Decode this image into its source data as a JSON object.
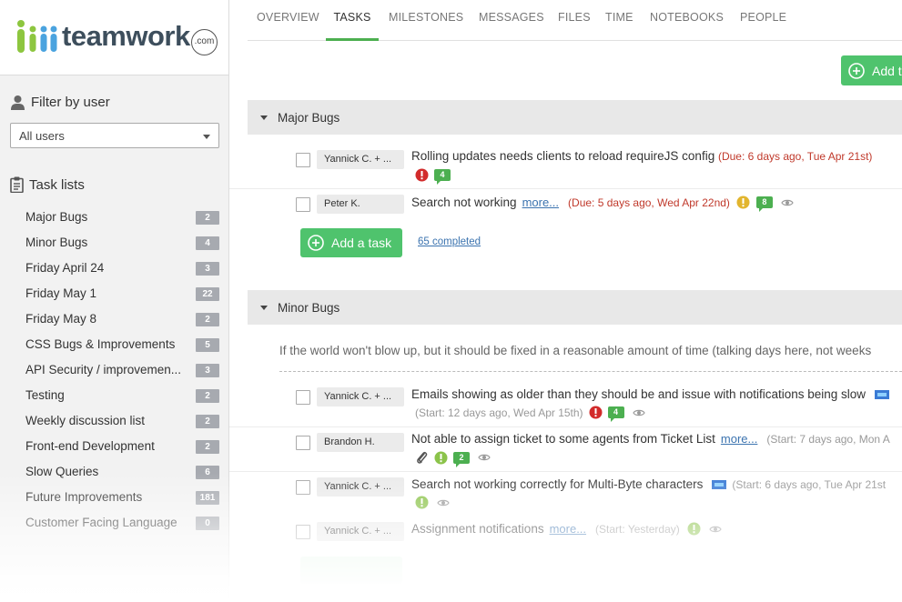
{
  "app": {
    "logo_text": "teamwork",
    "logo_suffix": ".com"
  },
  "sidebar": {
    "filter_heading": "Filter by user",
    "filter_value": "All users",
    "tasklists_heading": "Task lists",
    "task_lists": [
      {
        "name": "Major Bugs",
        "count": "2"
      },
      {
        "name": "Minor Bugs",
        "count": "4"
      },
      {
        "name": "Friday April 24",
        "count": "3"
      },
      {
        "name": "Friday May 1",
        "count": "22"
      },
      {
        "name": "Friday May 8",
        "count": "2"
      },
      {
        "name": "CSS Bugs & Improvements",
        "count": "5"
      },
      {
        "name": "API Security / improvemen...",
        "count": "3"
      },
      {
        "name": "Testing",
        "count": "2"
      },
      {
        "name": "Weekly discussion list",
        "count": "2"
      },
      {
        "name": "Front-end Development",
        "count": "2"
      },
      {
        "name": "Slow Queries",
        "count": "6"
      },
      {
        "name": "Future Improvements",
        "count": "181"
      },
      {
        "name": "Customer Facing Language",
        "count": "0"
      }
    ]
  },
  "nav": {
    "tabs": [
      "OVERVIEW",
      "TASKS",
      "MILESTONES",
      "MESSAGES",
      "FILES",
      "TIME",
      "NOTEBOOKS",
      "PEOPLE"
    ],
    "active": "TASKS"
  },
  "main": {
    "add_top_label": "Add t",
    "major": {
      "title": "Major Bugs",
      "tasks": [
        {
          "assignee": "Yannick C. + ...",
          "title": "Rolling updates needs clients to reload requireJS config",
          "due": "(Due: 6 days ago, Tue Apr 21st)",
          "comments": "4"
        },
        {
          "assignee": "Peter K.",
          "title": "Search not working",
          "more": "more...",
          "due": "(Due: 5 days ago, Wed Apr 22nd)",
          "comments": "8"
        }
      ],
      "add_task_label": "Add a task",
      "completed_label": "65 completed"
    },
    "minor": {
      "title": "Minor Bugs",
      "description": "If the world won't blow up, but it should be fixed in a reasonable amount of time (talking days here, not weeks",
      "tasks": [
        {
          "assignee": "Yannick C. + ...",
          "title": "Emails showing as older than they should be and issue with notifications being slow",
          "meta": "(Start: 12 days ago, Wed Apr 15th)",
          "comments": "4"
        },
        {
          "assignee": "Brandon H.",
          "title": "Not able to assign ticket to some agents from Ticket List",
          "more": "more...",
          "meta": "(Start: 7 days ago, Mon A",
          "comments": "2"
        },
        {
          "assignee": "Yannick C. + ...",
          "title": "Search not working correctly for Multi-Byte characters",
          "meta": "(Start: 6 days ago, Tue Apr 21st"
        },
        {
          "assignee": "Yannick C. + ...",
          "title": "Assignment notifications",
          "more": "more...",
          "meta": "(Start: Yesterday)"
        }
      ]
    }
  },
  "colors": {
    "accent_green": "#4fc36d",
    "due_red": "#c0392b",
    "link_blue": "#3b73af",
    "priority_high": "#d22b2b",
    "priority_medium": "#e2b52e",
    "priority_low": "#8bc34a"
  },
  "icons": {
    "filter": "user-icon",
    "tasklists": "clipboard-icon",
    "add": "plus-circle-icon",
    "priority": "exclamation-icon",
    "comments": "comment-icon",
    "watch": "eye-icon",
    "attachment": "paperclip-icon",
    "tag": "flag-icon"
  }
}
